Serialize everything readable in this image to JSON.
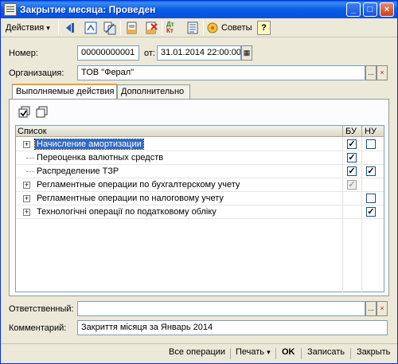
{
  "window": {
    "title": "Закрытие месяца: Проведен",
    "minimize": "_",
    "maximize": "□",
    "close": "×"
  },
  "toolbar": {
    "actions_label": "Действия",
    "tips_label": "Советы",
    "help_label": "?",
    "dtkt_label": "Дт\nКт"
  },
  "form": {
    "number_label": "Номер:",
    "number_value": "00000000001",
    "date_label": "от:",
    "date_value": "31.01.2014 22:00:00",
    "org_label": "Организация:",
    "org_value": "ТОВ \"Ферал\"",
    "responsible_label": "Ответственный:",
    "responsible_value": "",
    "comment_label": "Комментарий:",
    "comment_value": "Закриття місяця за Январь 2014"
  },
  "tabs": [
    {
      "label": "Выполняемые действия",
      "active": true
    },
    {
      "label": "Дополнительно",
      "active": false
    }
  ],
  "tree": {
    "col_list": "Список",
    "col_bu": "БУ",
    "col_nu": "НУ",
    "rows": [
      {
        "label": "Начисление амортизации",
        "expandable": true,
        "selected": true,
        "bu": "checked",
        "nu": "unchecked"
      },
      {
        "label": "Переоценка валютных средств",
        "expandable": false,
        "selected": false,
        "bu": "checked",
        "nu": "none"
      },
      {
        "label": "Распределение ТЗР",
        "expandable": false,
        "selected": false,
        "bu": "checked",
        "nu": "checked"
      },
      {
        "label": "Регламентные операции по бухгалтерскому учету",
        "expandable": true,
        "selected": false,
        "bu": "disabled-checked",
        "nu": "none"
      },
      {
        "label": "Регламентные операции по налоговому учету",
        "expandable": true,
        "selected": false,
        "bu": "none",
        "nu": "unchecked"
      },
      {
        "label": "Технологічні операції по податковому обліку",
        "expandable": true,
        "selected": false,
        "bu": "none",
        "nu": "checked"
      }
    ]
  },
  "bottom": {
    "all_ops": "Все операции",
    "print": "Печать",
    "ok": "OK",
    "save": "Записать",
    "close": "Закрыть"
  },
  "glyphs": {
    "dropdown": "▾",
    "ellipsis": "...",
    "clear": "×",
    "calendar": "▦",
    "plus": "+",
    "check": "✓"
  }
}
